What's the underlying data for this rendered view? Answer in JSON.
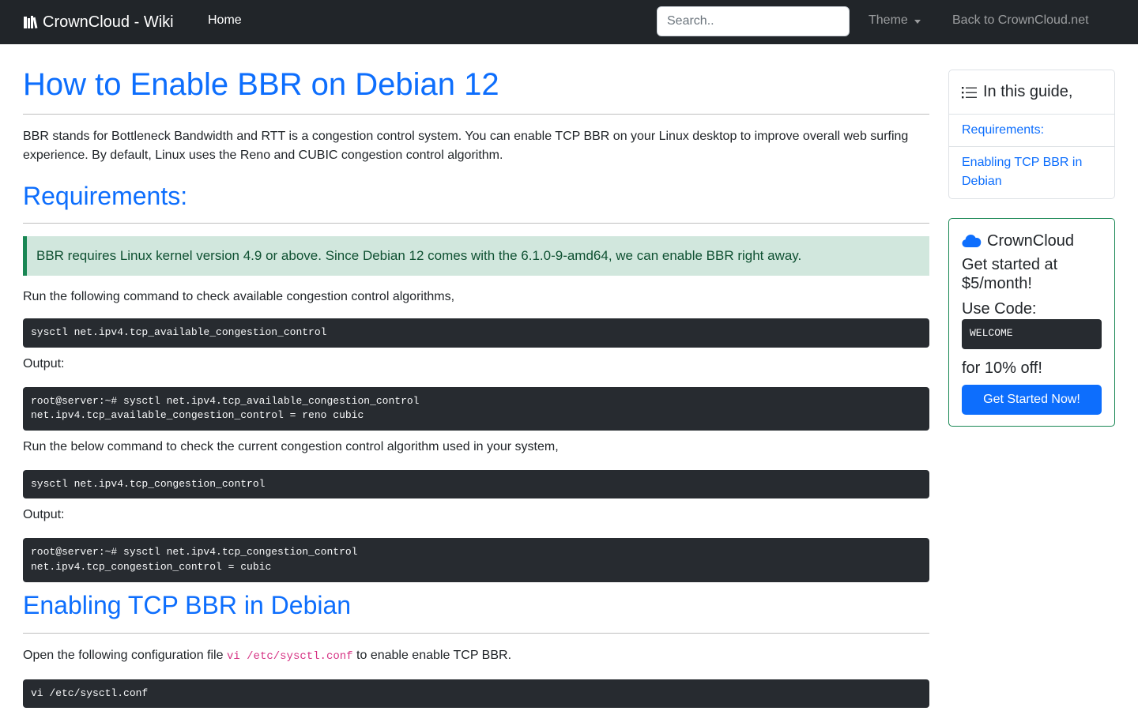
{
  "navbar": {
    "brand_icon": "books-icon",
    "brand": "CrownCloud - Wiki",
    "home": "Home",
    "search_placeholder": "Search..",
    "theme": "Theme",
    "back_link": "Back to CrownCloud.net"
  },
  "article": {
    "title": "How to Enable BBR on Debian 12",
    "intro": "BBR stands for Bottleneck Bandwidth and RTT is a congestion control system. You can enable TCP BBR on your Linux desktop to improve overall web surfing experience. By default, Linux uses the Reno and CUBIC congestion control algorithm.",
    "requirements_heading": "Requirements:",
    "alert": "BBR requires Linux kernel version 4.9 or above. Since Debian 12 comes with the 6.1.0-9-amd64, we can enable BBR right away.",
    "check_available_text": "Run the following command to check available congestion control algorithms,",
    "cmd_available": "sysctl net.ipv4.tcp_available_congestion_control",
    "output_label_1": "Output:",
    "output_available": "root@server:~# sysctl net.ipv4.tcp_available_congestion_control\nnet.ipv4.tcp_available_congestion_control = reno cubic",
    "check_current_text": "Run the below command to check the current congestion control algorithm used in your system,",
    "cmd_current": "sysctl net.ipv4.tcp_congestion_control",
    "output_label_2": "Output:",
    "output_current": "root@server:~# sysctl net.ipv4.tcp_congestion_control\nnet.ipv4.tcp_congestion_control = cubic",
    "enabling_heading": "Enabling TCP BBR in Debian",
    "open_config_prefix": "Open the following configuration file ",
    "open_config_code": "vi /etc/sysctl.conf",
    "open_config_suffix": " to enable enable TCP BBR.",
    "cmd_vi": "vi /etc/sysctl.conf"
  },
  "toc": {
    "icon": "list-icon",
    "heading": "In this guide,",
    "items": [
      "Requirements:",
      "Enabling TCP BBR in Debian"
    ]
  },
  "promo": {
    "icon": "cloud-icon",
    "heading": "CrownCloud",
    "line1": "Get started at $5/month!",
    "line2": "Use Code:",
    "code": "WELCOME",
    "line3": "for 10% off!",
    "button": "Get Started Now!"
  },
  "colors": {
    "navbar_bg": "#212529",
    "link": "#0d6efd",
    "alert_bg": "#d1e7dd",
    "alert_border": "#198754",
    "code_bg": "#272b30",
    "inline_code": "#d63384"
  }
}
